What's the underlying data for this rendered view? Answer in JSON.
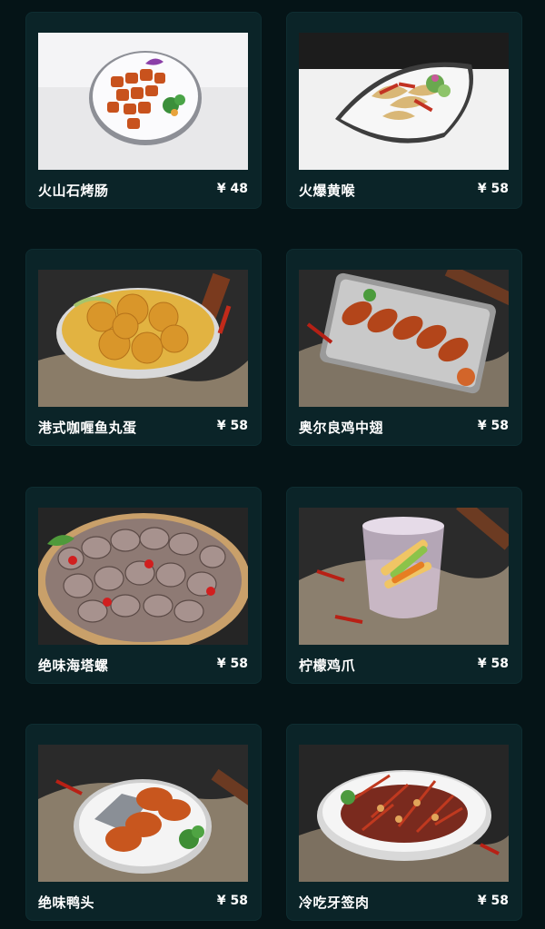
{
  "colors": {
    "page_background": "#051417",
    "card_background": "#0b2428",
    "text": "#ffffff"
  },
  "menu": {
    "items": [
      {
        "name": "火山石烤肠",
        "price": "¥ 48",
        "photo": "grilled-sausage-plate"
      },
      {
        "name": "火爆黄喉",
        "price": "¥ 58",
        "photo": "spicy-aorta-dish"
      },
      {
        "name": "港式咖喱鱼丸蛋",
        "price": "¥ 58",
        "photo": "curry-fish-balls-bowl"
      },
      {
        "name": "奥尔良鸡中翅",
        "price": "¥ 58",
        "photo": "orleans-chicken-wings-tray"
      },
      {
        "name": "绝味海塔螺",
        "price": "¥ 58",
        "photo": "sea-snails-basket"
      },
      {
        "name": "柠檬鸡爪",
        "price": "¥ 58",
        "photo": "lemon-chicken-feet-bowl"
      },
      {
        "name": "绝味鸭头",
        "price": "¥ 58",
        "photo": "duck-heads-plate"
      },
      {
        "name": "冷吃牙签肉",
        "price": "¥ 58",
        "photo": "toothpick-meat-bowl"
      }
    ]
  }
}
